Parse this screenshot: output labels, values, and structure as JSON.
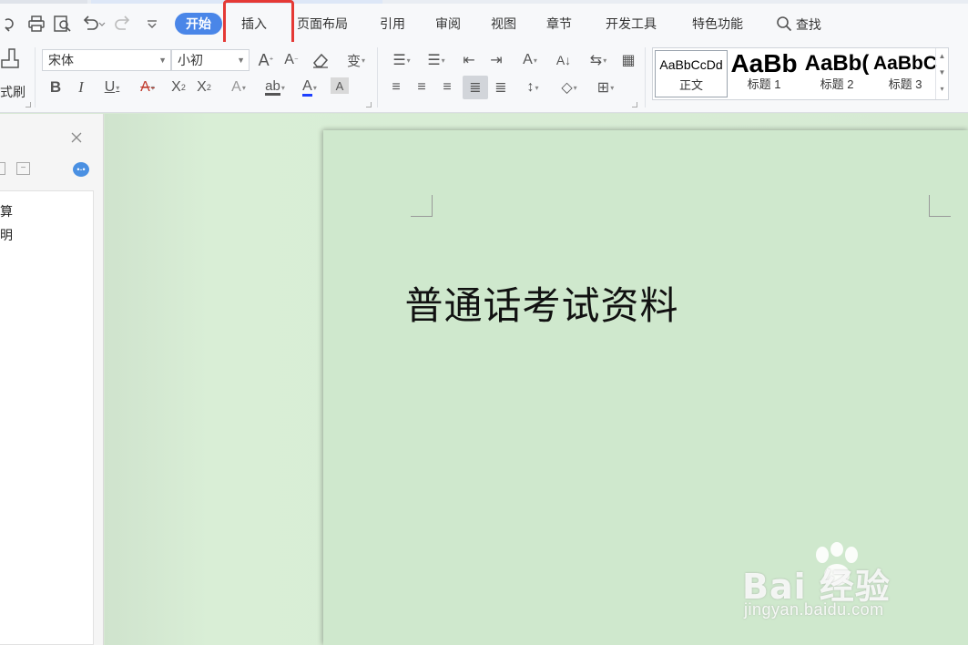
{
  "menu": {
    "tabs": [
      {
        "label": "开始"
      },
      {
        "label": "插入"
      },
      {
        "label": "页面布局"
      },
      {
        "label": "引用"
      },
      {
        "label": "审阅"
      },
      {
        "label": "视图"
      },
      {
        "label": "章节"
      },
      {
        "label": "开发工具"
      },
      {
        "label": "特色功能"
      }
    ],
    "search_label": "查找",
    "active_tab": "开始",
    "highlighted_tab": "插入"
  },
  "ribbon": {
    "format_painter_label": "式刷",
    "font_name": "宋体",
    "font_size": "小初",
    "styles": [
      {
        "sample": "AaBbCcDd",
        "name": "正文"
      },
      {
        "sample": "AaBb",
        "name": "标题 1"
      },
      {
        "sample": "AaBb(",
        "name": "标题 2"
      },
      {
        "sample": "AaBbC",
        "name": "标题 3"
      }
    ]
  },
  "left_pane": {
    "items": [
      "算",
      "明"
    ]
  },
  "document": {
    "title": "普通话考试资料"
  },
  "watermark": {
    "brand": "Bai  经验",
    "url": "jingyan.baidu.com"
  },
  "colors": {
    "accent": "#4a86e8",
    "highlight_box": "#e53935",
    "page_bg": "#cfe8cd"
  }
}
